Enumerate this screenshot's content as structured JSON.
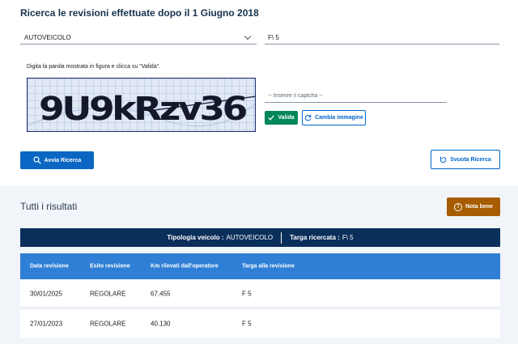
{
  "page_title": "Ricerca le revisioni effettuate dopo il 1 Giugno 2018",
  "search": {
    "vehicle_type": "AUTOVEICOLO",
    "plate_value": "F\\ 5"
  },
  "captcha": {
    "hint": "Digita la parola mostrata in figura e clicca su \"Valida\".",
    "image_text": "9U9kRzv36",
    "placeholder": "-- Inserire il captcha --",
    "validate_label": "Valida",
    "change_image_label": "Cambia immagine"
  },
  "actions": {
    "search_label": "Avvia Ricerca",
    "clear_label": "Svuota Ricerca"
  },
  "results": {
    "title": "Tutti i risultati",
    "note_label": "Nota bene",
    "summary": {
      "vehicle_type_label": "Tipologia veicolo :",
      "vehicle_type_value": "AUTOVEICOLO",
      "plate_label": "Targa ricercata :",
      "plate_value": "F\\ 5"
    },
    "columns": [
      "Data revisione",
      "Esito revisione",
      "Km rilevati dall'operatore",
      "Targa alla revisione"
    ],
    "rows": [
      [
        "30/01/2025",
        "REGOLARE",
        "67.455",
        "F 5"
      ],
      [
        "27/01/2023",
        "REGOLARE",
        "40.130",
        "F 5"
      ]
    ]
  },
  "colors": {
    "primary": "#0a66c2",
    "success": "#008758",
    "warning": "#a75c00",
    "navy": "#0a2f5a",
    "table_header": "#2f7fd6"
  }
}
